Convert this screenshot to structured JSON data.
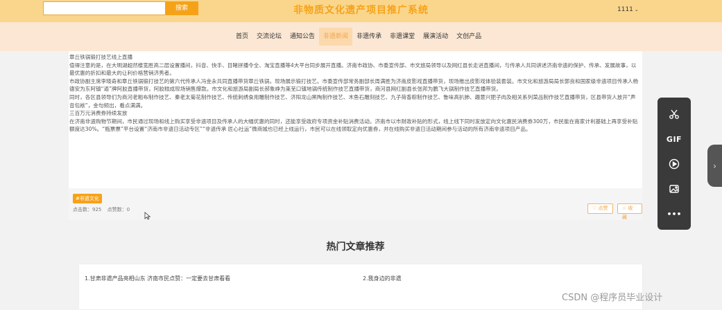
{
  "header": {
    "search_placeholder": "",
    "search_button": "搜索",
    "site_title": "非物质文化遗产项目推广系统",
    "username": "1111",
    "caret": "⌄"
  },
  "nav": {
    "items": [
      {
        "label": "首页",
        "active": false
      },
      {
        "label": "交流论坛",
        "active": false
      },
      {
        "label": "通知公告",
        "active": false
      },
      {
        "label": "非遗新闻",
        "active": true
      },
      {
        "label": "非遗传承",
        "active": false
      },
      {
        "label": "非遗课堂",
        "active": false
      },
      {
        "label": "展演活动",
        "active": false
      },
      {
        "label": "文创产品",
        "active": false
      }
    ]
  },
  "article": {
    "paragraphs": [
      "章丘铁锅锻打技艺线上直播",
      "值得注意的是，在大明湖超然楼宽胜高二层设置播间，抖音、快手、目睹拼播令全、淘宝直播等4大平台同步展开直播。济南市政协、市委宣传部、市文旅局领导以及网红县长走进直播间，与传承人共同讲述济南非遗的保护、传承、发展故事，以最优惠的折扣和最大的让利价格营销济秀者。",
      "市政协副主席李晓奇和章丘铁锅锻打技艺的第六代传承人冯金永共同直播带货章丘铁锅，现场展示锻打技艺。市委宣传部常务副部长周满胜为济南皮影戏直播带货，现场推出皮影戏体验装套装。市文化和旅游局局长郭良和国家级非遗项目传承人杨德安为东阿镇“遒”牌阿胶直播带货，阿胶糕成现场销售爆款。市文化和旅游局副局长郝象峥为莱芜口镇地锅传统制作技艺直播带货，商河县网红副县长张邦为鹏飞大锅制作技艺直播带货。",
      "同时，各区县领导们为商河老粗布制作技艺、秦老太菊花制作技艺、传统刺绣食用雕制作技艺、济阳龙山黑陶制作技艺、木鱼石雕刻技艺、九子荷香粽制作技艺、鲁味高扒肺、趣意兴肥子肉及相关系列菜品制作技艺直播带货，区县带货人放开“声音包袱”，金句频出，看点满满。",
      "三百万元消费券持续发放",
      "在济南非遗购物节期间，市民通过现场和线上购买享受非遗项目及传承人的大幅优惠的同时，还能享受政府专项资金补贴消费活动。济南市以市财政补贴的形式，线上线下同时发放定向文化惠民消费券300万，市民能在南家计利基础上再享受补贴额度达30%。“瓶票票”平台设置“济南市非遗日活动专区”“非遗传承 匠心社运”微商城也已经上线运行，市民可以在线领取定向优惠券，并在线购买非遗日活动期间参与活动的所有济南非遗项目产品。"
    ],
    "tag": "#非遗文化",
    "clicks_label": "点击数：925",
    "likes_label": "点赞数：0",
    "like_button": "♡ 点赞",
    "fav_button": "☆ 收藏"
  },
  "recommend": {
    "title": "热门文章推荐",
    "items": [
      "1.甘肃非遗产品亮相山东 济南市民点赞：一定要去甘肃看看",
      "2.我身边的非遗"
    ]
  },
  "toolbar": {
    "gif_label": "GIF",
    "more_label": "•••"
  },
  "side_tab": {
    "arrow": "›"
  },
  "watermark": "CSDN @程序员毕业设计"
}
